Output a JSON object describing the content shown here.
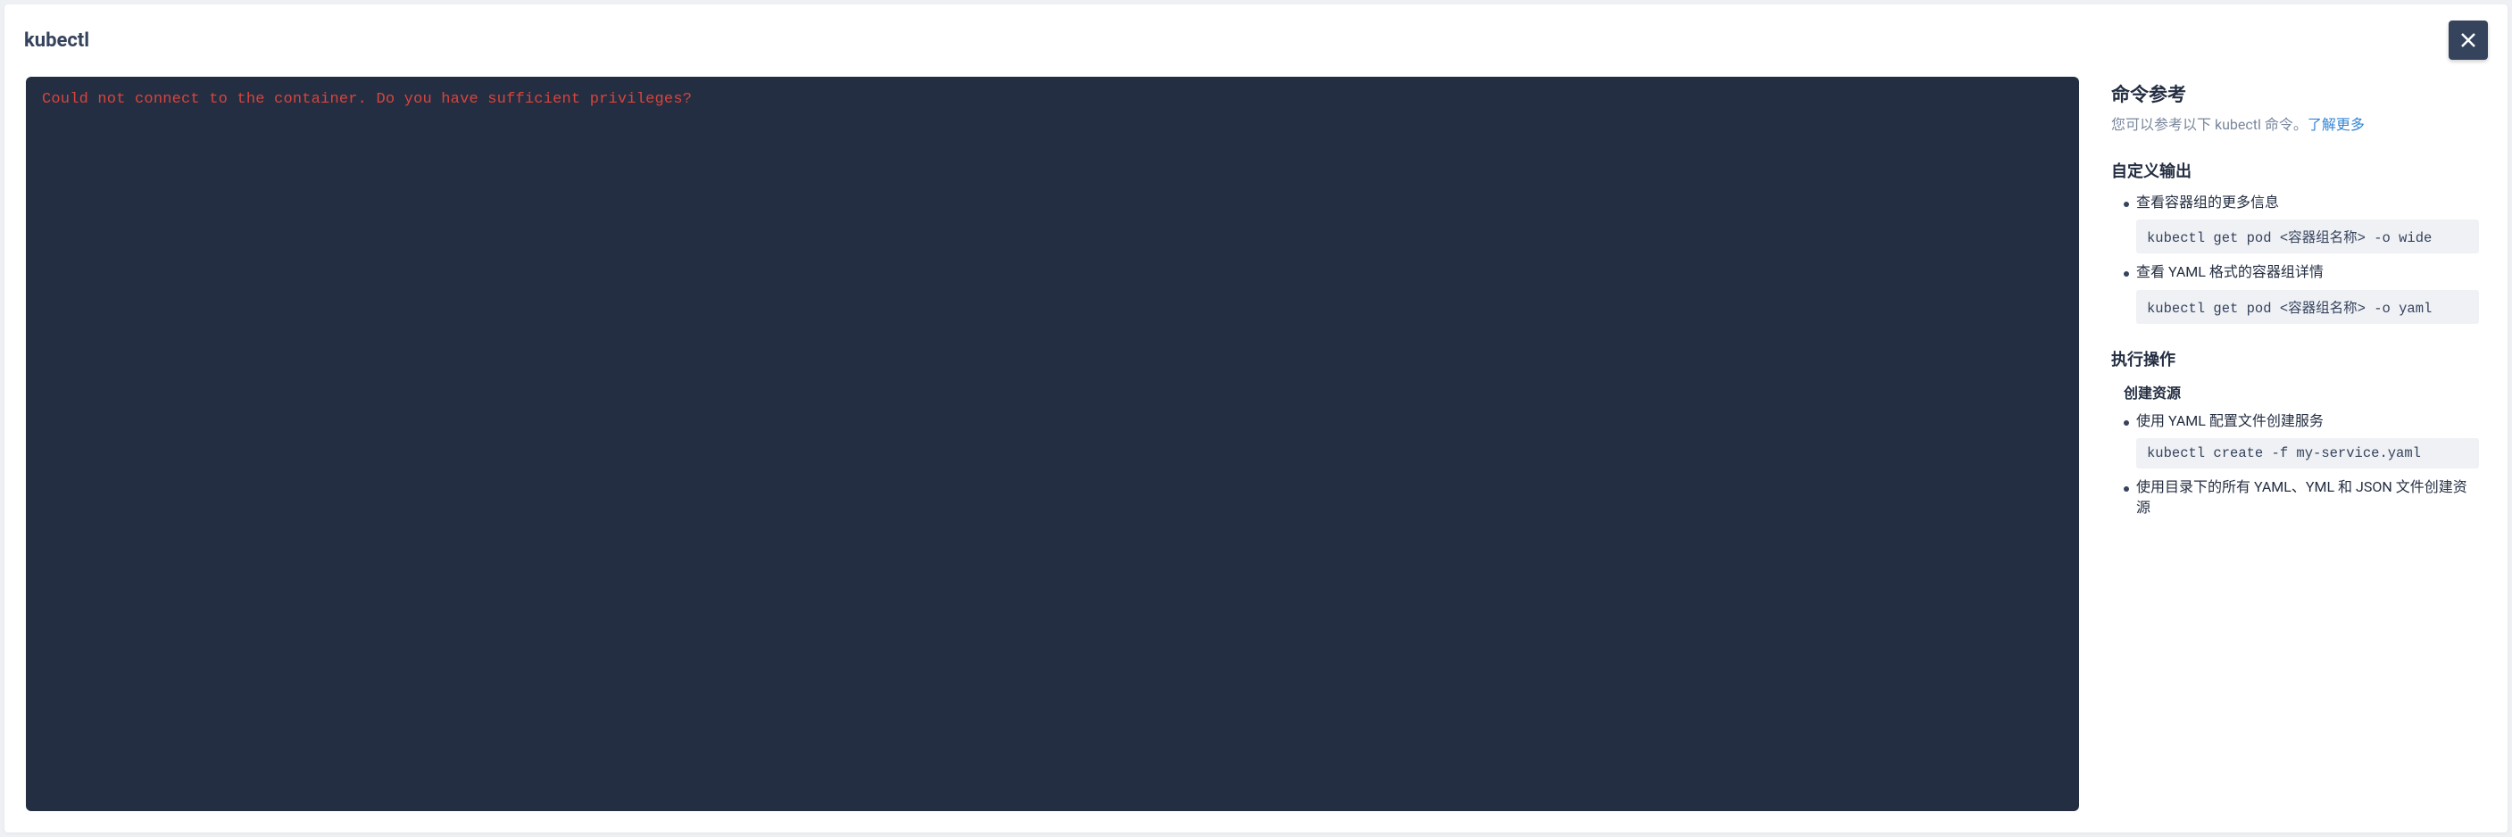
{
  "header": {
    "title": "kubectl"
  },
  "terminal": {
    "error_message": "Could not connect to the container. Do you have sufficient privileges?"
  },
  "reference": {
    "title": "命令参考",
    "subtitle_prefix": "您可以参考以下 kubectl 命令。",
    "learn_more": "了解更多",
    "sections": [
      {
        "title": "自定义输出",
        "items": [
          {
            "desc": "查看容器组的更多信息",
            "code": "kubectl get pod <容器组名称> -o wide"
          },
          {
            "desc": "查看 YAML 格式的容器组详情",
            "code": "kubectl get pod <容器组名称> -o yaml"
          }
        ]
      },
      {
        "title": "执行操作",
        "subsections": [
          {
            "title": "创建资源",
            "items": [
              {
                "desc": "使用 YAML 配置文件创建服务",
                "code": "kubectl create -f my-service.yaml"
              },
              {
                "desc": "使用目录下的所有 YAML、YML 和 JSON 文件创建资源",
                "code": ""
              }
            ]
          }
        ]
      }
    ]
  }
}
